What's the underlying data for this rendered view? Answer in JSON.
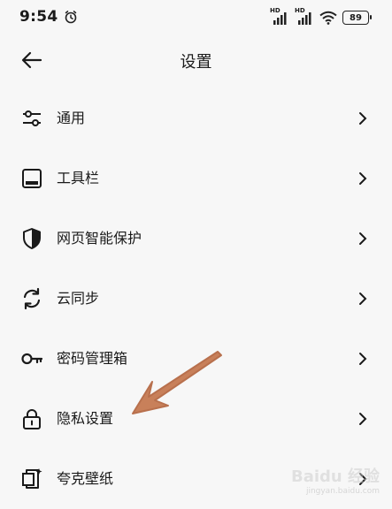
{
  "status": {
    "time": "9:54",
    "signal_labels": [
      "HD",
      "HD"
    ],
    "battery": "89"
  },
  "header": {
    "title": "设置"
  },
  "settings_items": [
    {
      "label": "通用",
      "icon": "sliders-icon"
    },
    {
      "label": "工具栏",
      "icon": "toolbar-icon"
    },
    {
      "label": "网页智能保护",
      "icon": "shield-icon"
    },
    {
      "label": "云同步",
      "icon": "sync-icon"
    },
    {
      "label": "密码管理箱",
      "icon": "key-icon"
    },
    {
      "label": "隐私设置",
      "icon": "lock-icon"
    },
    {
      "label": "夸克壁纸",
      "icon": "wallpaper-icon"
    }
  ],
  "colors": {
    "annotation_arrow": "#c8805a",
    "background": "#f7f7f7"
  },
  "watermark": {
    "top": "Baidu 经验",
    "bottom": "jingyan.baidu.com"
  }
}
